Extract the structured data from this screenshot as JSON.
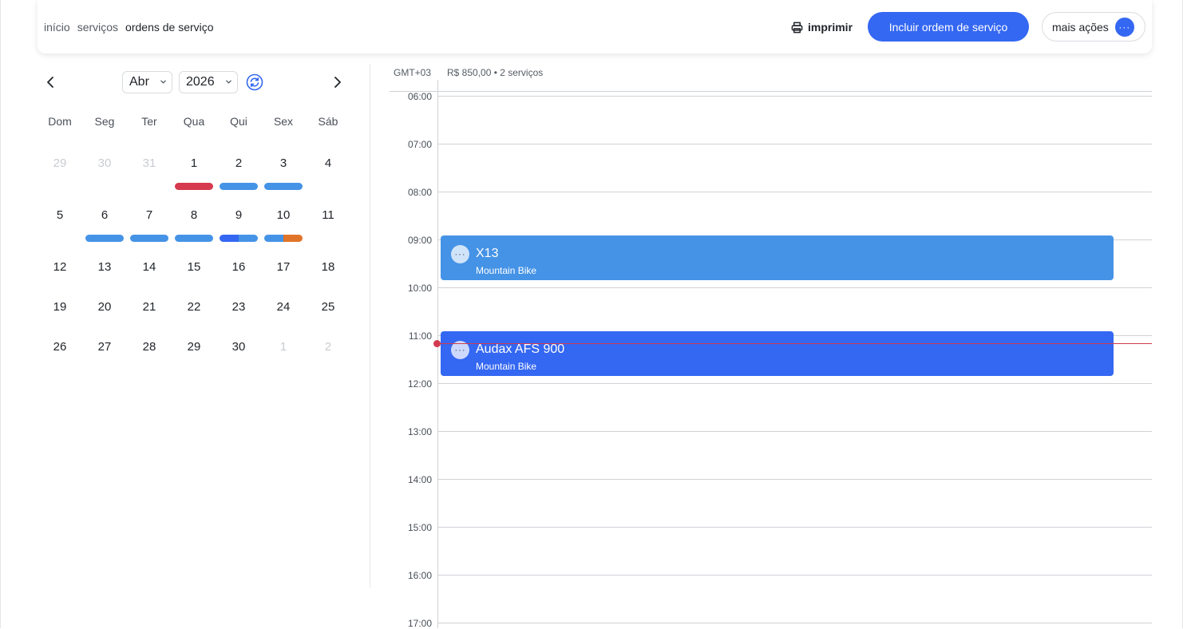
{
  "breadcrumb": [
    "início",
    "serviços",
    "ordens de serviço"
  ],
  "header": {
    "print_label": "imprimir",
    "primary_label": "Incluir ordem de serviço",
    "more_label": "mais ações",
    "more_glyph": "···"
  },
  "calendar": {
    "month": "Abr",
    "year": "2026",
    "weekdays": [
      "Dom",
      "Seg",
      "Ter",
      "Qua",
      "Qui",
      "Sex",
      "Sáb"
    ],
    "weeks": [
      [
        {
          "n": "29",
          "muted": true
        },
        {
          "n": "30",
          "muted": true
        },
        {
          "n": "31",
          "muted": true
        },
        {
          "n": "1",
          "bars": [
            "#d63a4e"
          ]
        },
        {
          "n": "2",
          "bars": [
            "#4593e6"
          ]
        },
        {
          "n": "3",
          "bars": [
            "#4593e6"
          ]
        },
        {
          "n": "4"
        }
      ],
      [
        {
          "n": "5"
        },
        {
          "n": "6",
          "bars": [
            "#4593e6"
          ]
        },
        {
          "n": "7",
          "bars": [
            "#4593e6"
          ]
        },
        {
          "n": "8",
          "bars": [
            "#4593e6"
          ]
        },
        {
          "n": "9",
          "selected": true,
          "bars": [
            "#3467f2",
            "#4593e6"
          ]
        },
        {
          "n": "10",
          "bars": [
            "#4593e6",
            "#e07428"
          ]
        },
        {
          "n": "11"
        }
      ],
      [
        {
          "n": "12"
        },
        {
          "n": "13"
        },
        {
          "n": "14"
        },
        {
          "n": "15"
        },
        {
          "n": "16"
        },
        {
          "n": "17"
        },
        {
          "n": "18"
        }
      ],
      [
        {
          "n": "19"
        },
        {
          "n": "20"
        },
        {
          "n": "21"
        },
        {
          "n": "22"
        },
        {
          "n": "23"
        },
        {
          "n": "24"
        },
        {
          "n": "25"
        }
      ],
      [
        {
          "n": "26"
        },
        {
          "n": "27"
        },
        {
          "n": "28"
        },
        {
          "n": "29"
        },
        {
          "n": "30"
        },
        {
          "n": "1",
          "muted": true
        },
        {
          "n": "2",
          "muted": true
        }
      ]
    ]
  },
  "dayview": {
    "timezone": "GMT+03",
    "summary": "R$ 850,00 • 2 serviços",
    "hours": [
      "06:00",
      "07:00",
      "08:00",
      "09:00",
      "10:00",
      "11:00",
      "12:00",
      "13:00",
      "14:00",
      "15:00",
      "16:00",
      "17:00"
    ],
    "events": [
      {
        "title": "X13",
        "subtitle": "Mountain Bike",
        "color": "#4593e6",
        "start_hour": 9.0
      },
      {
        "title": "Audax AFS 900",
        "subtitle": "Mountain Bike",
        "color": "#3467f2",
        "start_hour": 11.0
      }
    ],
    "event_glyph": "···",
    "now_color": "#d13a4f"
  },
  "colors": {
    "accent": "#3467f2",
    "service_blue": "#4593e6",
    "alert_red": "#d63a4e",
    "warning_orange": "#e07428",
    "selected_day": "#dbe8fb"
  }
}
